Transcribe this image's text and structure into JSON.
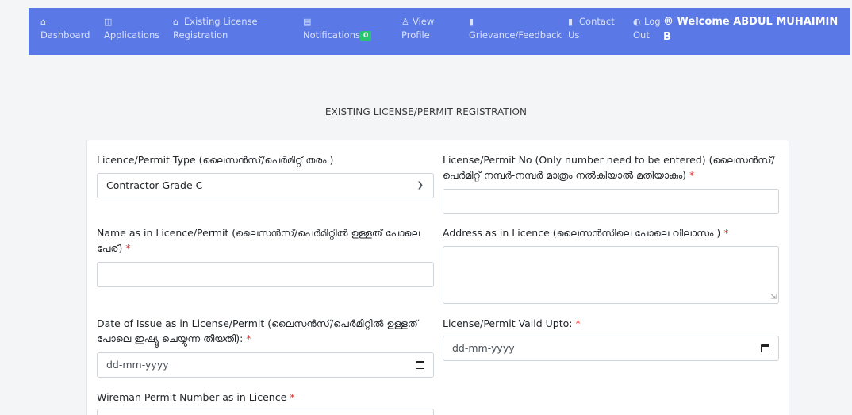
{
  "nav": {
    "items": [
      {
        "icon": "⌂",
        "line1": "",
        "line2": "Dashboard"
      },
      {
        "icon": "◫",
        "line1": "",
        "line2": "Applications"
      },
      {
        "icon": "⌂",
        "line1": "Existing License",
        "line2": "Registration"
      },
      {
        "icon": "▤",
        "line1": "",
        "line2": "Notifications"
      },
      {
        "icon": "♙",
        "line1": "View",
        "line2": "Profile"
      },
      {
        "icon": "▮",
        "line1": "",
        "line2": "Grievance/Feedback"
      },
      {
        "icon": "▮",
        "line1": "Contact",
        "line2": "Us"
      },
      {
        "icon": "◐",
        "line1": "Log",
        "line2": "Out"
      }
    ],
    "notification_count": "0",
    "welcome_icon": "®",
    "welcome_text": "Welcome ABDUL MUHAIMIN B"
  },
  "page": {
    "title": "EXISTING LICENSE/PERMIT REGISTRATION"
  },
  "form": {
    "licence_type": {
      "label": "Licence/Permit Type (ലൈസൻസ്/പെർമിറ്റ് തരം )",
      "value": "Contractor Grade C"
    },
    "licence_no": {
      "label": "License/Permit No (Only number need to be entered) (ലൈസൻസ്/ പെർമിറ്റ് നമ്പർ-നമ്പർ മാത്രം നൽകിയാൽ മതിയാകും)",
      "required": "*",
      "value": ""
    },
    "name": {
      "label": "Name as in Licence/Permit (ലൈസൻസ്/പെർമിറ്റിൽ ഉള്ളത് പോലെ പേര്)",
      "required": "*",
      "value": ""
    },
    "address": {
      "label": "Address as in Licence (ലൈസൻസിലെ പോലെ വിലാസം )",
      "required": "*",
      "value": ""
    },
    "date_of_issue": {
      "label": "Date of Issue as in License/Permit (ലൈസൻസ്/പെർമിറ്റിൽ ഉള്ളത് പോലെ ഇഷ്യൂ ചെയ്യുന്ന തീയതി):",
      "required": "*",
      "placeholder": "dd-mm-yyyy"
    },
    "valid_upto": {
      "label": "License/Permit Valid Upto:",
      "required": "*",
      "placeholder": "dd-mm-yyyy"
    },
    "wireman_permit": {
      "label": "Wireman Permit Number as in Licence",
      "required": "*"
    }
  },
  "colors": {
    "navbar": "#5a78e6",
    "badge": "#28c76f",
    "required": "#e03131"
  }
}
